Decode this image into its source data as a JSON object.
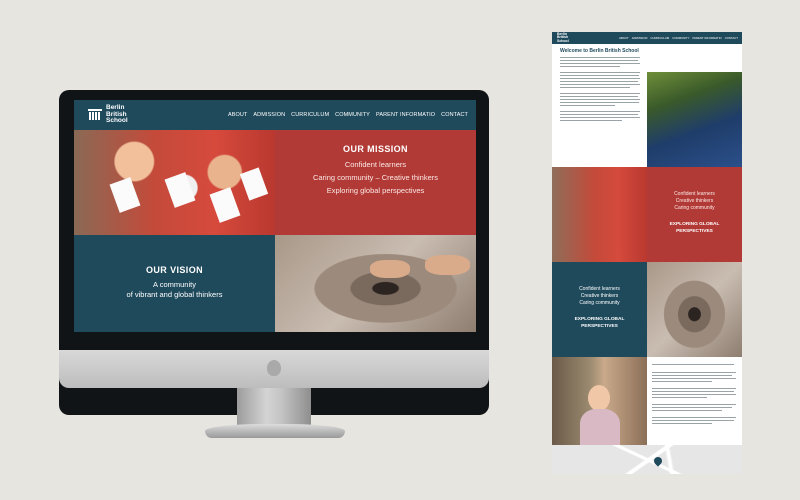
{
  "site": {
    "logo_line1": "Berlin",
    "logo_line2": "British",
    "logo_line3": "School",
    "nav": [
      "ABOUT",
      "ADMISSION",
      "CURRICULUM",
      "COMMUNITY",
      "PARENT INFORMATIO",
      "CONTACT"
    ]
  },
  "mission": {
    "title": "OUR MISSION",
    "lines": [
      "Confident learners",
      "Caring community – Creative thinkers",
      "Exploring global perspectives"
    ]
  },
  "vision": {
    "title": "OUR VISION",
    "line1": "A community",
    "line2": "of vibrant and global thinkers"
  },
  "longpage": {
    "welcome_title": "Welcome to Berlin British School",
    "red_lines": [
      "Confident learners",
      "Creative thinkers",
      "Caring community"
    ],
    "red_heading_1": "EXPLORING GLOBAL",
    "red_heading_2": "PERSPECTIVES",
    "blue_lines": [
      "Confident learners",
      "Creative thinkers",
      "Caring community"
    ],
    "blue_heading_1": "EXPLORING GLOBAL",
    "blue_heading_2": "PERSPECTIVES"
  },
  "colors": {
    "brand_teal": "#1f4a5c",
    "brand_red": "#b23a36",
    "background": "#e7e5e0"
  }
}
